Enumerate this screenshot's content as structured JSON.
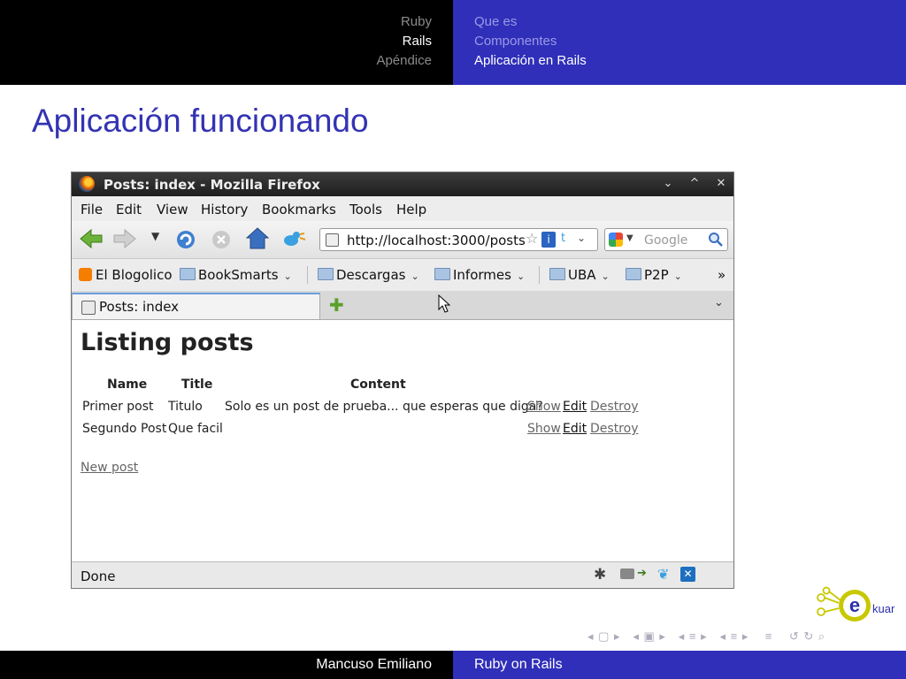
{
  "header": {
    "sections": [
      {
        "label": "Ruby",
        "active": false
      },
      {
        "label": "Rails",
        "active": true
      },
      {
        "label": "Apéndice",
        "active": false
      }
    ],
    "subsections": [
      {
        "label": "Que es",
        "active": false
      },
      {
        "label": "Componentes",
        "active": false
      },
      {
        "label": "Aplicación en Rails",
        "active": true
      }
    ]
  },
  "slide": {
    "title": "Aplicación funcionando"
  },
  "browser": {
    "window_title": "Posts: index - Mozilla Firefox",
    "menu": [
      "File",
      "Edit",
      "View",
      "History",
      "Bookmarks",
      "Tools",
      "Help"
    ],
    "url": "http://localhost:3000/posts",
    "search_placeholder": "Google",
    "bookmarks": [
      "El Blogolico",
      "BookSmarts",
      "Descargas",
      "Informes",
      "UBA",
      "P2P"
    ],
    "bookmarks_overflow": "»",
    "tab_title": "Posts: index",
    "status": "Done"
  },
  "page": {
    "heading": "Listing posts",
    "columns": [
      "Name",
      "Title",
      "Content"
    ],
    "rows": [
      {
        "name": "Primer post",
        "title": "Titulo",
        "content": "Solo es un post de prueba... que esperas que diga?",
        "show": "Show",
        "edit": "Edit",
        "destroy": "Destroy"
      },
      {
        "name": "Segundo Post",
        "title": "Que facil",
        "content": "",
        "show": "Show",
        "edit": "Edit",
        "destroy": "Destroy"
      }
    ],
    "new_link": "New post"
  },
  "footer": {
    "author": "Mancuso Emiliano",
    "title": "Ruby on Rails",
    "logo_text": "kuar"
  },
  "colors": {
    "beamer_blue": "#2f2fb9",
    "title_blue": "#3333b3"
  }
}
